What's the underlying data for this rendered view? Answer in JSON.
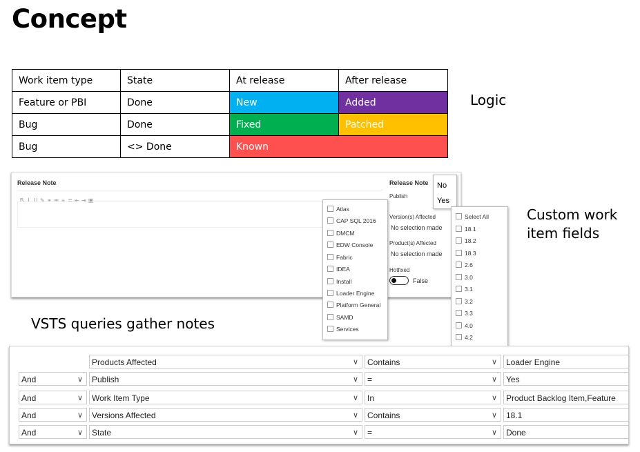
{
  "title": "Concept",
  "logic_label": "Logic",
  "custom_fields_label": "Custom work item fields",
  "queries_label": "VSTS queries gather notes",
  "logic_table": {
    "headers": [
      "Work item type",
      "State",
      "At release",
      "After release"
    ],
    "rows": [
      {
        "type": "Feature or PBI",
        "state": "Done",
        "at_release": "New",
        "at_color": "#00B0F0",
        "after_release": "Added",
        "after_color": "#7030A0"
      },
      {
        "type": "Bug",
        "state": "Done",
        "at_release": "Fixed",
        "at_color": "#00B050",
        "after_release": "Patched",
        "after_color": "#FFC000"
      },
      {
        "type": "Bug",
        "state": "<> Done",
        "at_release": "Known",
        "at_color": "#FF5050",
        "after_release": "",
        "after_color": "#FF5050"
      }
    ]
  },
  "form": {
    "release_note_title": "Release Note",
    "toolbar_icons": [
      "B",
      "I",
      "U",
      "Ab",
      "link",
      "strike",
      "ul",
      "ol",
      "outdent",
      "indent",
      "image"
    ],
    "right_release_note": "Release Note",
    "publish_label": "Publish",
    "publish_options": [
      "No",
      "Yes"
    ],
    "versions_affected_label": "Version(s) Affected",
    "versions_placeholder": "No selection made",
    "products_affected_label": "Product(s) Affected",
    "products_placeholder": "No selection made",
    "hotfixed_label": "Hotfixed",
    "hotfixed_value": "False",
    "products_list": [
      "Atlas",
      "CAP SQL 2016",
      "DMCM",
      "EDW Console",
      "Fabric",
      "IDEA",
      "Install",
      "Loader Engine",
      "Platform General",
      "SAMD",
      "Services"
    ],
    "versions_list": [
      "Select All",
      "18.1",
      "18.2",
      "18.3",
      "2.6",
      "3.0",
      "3.1",
      "3.2",
      "3.3",
      "4.0",
      "4.2"
    ]
  },
  "query_rows": [
    {
      "op": "",
      "field": "Products Affected",
      "operator": "Contains",
      "value": "Loader Engine"
    },
    {
      "op": "And",
      "field": "Publish",
      "operator": "=",
      "value": "Yes"
    },
    {
      "op": "And",
      "field": "Work Item Type",
      "operator": "In",
      "value": "Product Backlog Item,Feature"
    },
    {
      "op": "And",
      "field": "Versions Affected",
      "operator": "Contains",
      "value": "18.1"
    },
    {
      "op": "And",
      "field": "State",
      "operator": "=",
      "value": "Done"
    }
  ],
  "icons": {
    "chevron": "chevron-down-icon",
    "toggle": "toggle-switch-icon",
    "checkbox": "checkbox-icon"
  }
}
